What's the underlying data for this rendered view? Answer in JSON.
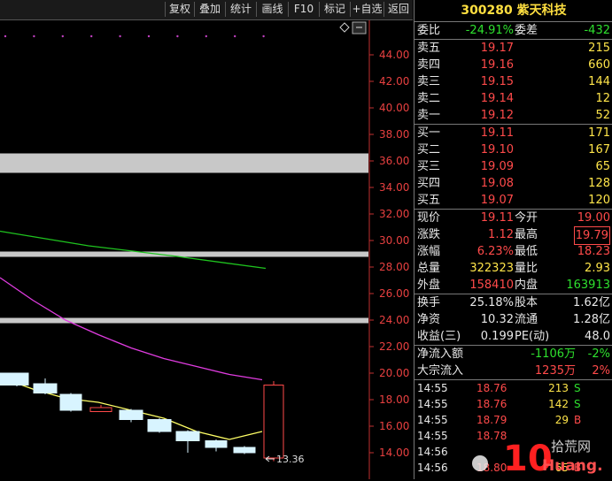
{
  "toolbar": {
    "buttons": [
      "复权",
      "叠加",
      "统计",
      "画线",
      "F10",
      "标记",
      "+自选",
      "返回"
    ]
  },
  "chart": {
    "y_ticks": [
      "44.00",
      "42.00",
      "40.00",
      "38.00",
      "36.00",
      "34.00",
      "32.00",
      "30.00",
      "28.00",
      "26.00",
      "24.00",
      "22.00",
      "20.00",
      "18.00",
      "16.00",
      "14.00"
    ],
    "low_label": "13.36",
    "corner_icon": "diamond-icon"
  },
  "chart_data": {
    "type": "candlestick",
    "ylim": [
      13,
      45.2
    ],
    "y_ticks": [
      44,
      42,
      40,
      38,
      36,
      34,
      32,
      30,
      28,
      26,
      24,
      22,
      20,
      18,
      16,
      14
    ],
    "candles": [
      {
        "open": 20.0,
        "close": 19.1,
        "high": 20.0,
        "low": 19.0,
        "dir": "down"
      },
      {
        "open": 19.2,
        "close": 18.5,
        "high": 19.6,
        "low": 18.4,
        "dir": "down"
      },
      {
        "open": 18.4,
        "close": 17.2,
        "high": 18.5,
        "low": 17.1,
        "dir": "down"
      },
      {
        "open": 17.1,
        "close": 17.4,
        "high": 17.6,
        "low": 17.1,
        "dir": "up"
      },
      {
        "open": 17.2,
        "close": 16.5,
        "high": 17.3,
        "low": 16.3,
        "dir": "down"
      },
      {
        "open": 16.5,
        "close": 15.6,
        "high": 16.6,
        "low": 15.5,
        "dir": "down"
      },
      {
        "open": 15.6,
        "close": 14.9,
        "high": 15.7,
        "low": 14.0,
        "dir": "down"
      },
      {
        "open": 14.9,
        "close": 14.4,
        "high": 15.0,
        "low": 14.1,
        "dir": "down"
      },
      {
        "open": 14.4,
        "close": 14.0,
        "high": 14.5,
        "low": 13.9,
        "dir": "down"
      },
      {
        "open": 13.6,
        "close": 19.1,
        "high": 19.4,
        "low": 13.36,
        "dir": "up"
      }
    ],
    "ma_green": {
      "x_start": 0,
      "values": [
        30.7,
        29.6,
        28.8,
        27.9
      ]
    },
    "ma_magenta": {
      "values": [
        27.2,
        25.5,
        24.0,
        22.9,
        21.9,
        21.1,
        20.5,
        19.9,
        19.5
      ]
    },
    "ma_yellow": {
      "values": [
        19.7,
        18.8,
        18.1,
        17.8,
        17.2,
        16.6,
        15.6,
        15.0,
        15.6
      ]
    },
    "bands": [
      35.9,
      28.5,
      23.5
    ]
  },
  "quote": {
    "code": "300280",
    "name": "紫天科技",
    "title": "300280 紫天科技",
    "weibi_label": "委比",
    "weibi": "-24.91%",
    "weicha_label": "委差",
    "weicha": "-432",
    "sells": [
      {
        "label": "卖五",
        "price": "19.17",
        "vol": "215"
      },
      {
        "label": "卖四",
        "price": "19.16",
        "vol": "660"
      },
      {
        "label": "卖三",
        "price": "19.15",
        "vol": "144"
      },
      {
        "label": "卖二",
        "price": "19.14",
        "vol": "12"
      },
      {
        "label": "卖一",
        "price": "19.12",
        "vol": "52"
      }
    ],
    "buys": [
      {
        "label": "买一",
        "price": "19.11",
        "vol": "171"
      },
      {
        "label": "买二",
        "price": "19.10",
        "vol": "167"
      },
      {
        "label": "买三",
        "price": "19.09",
        "vol": "65"
      },
      {
        "label": "买四",
        "price": "19.08",
        "vol": "128"
      },
      {
        "label": "买五",
        "price": "19.07",
        "vol": "120"
      }
    ],
    "stats": [
      {
        "l1": "现价",
        "v1": "19.11",
        "l2": "今开",
        "v2": "19.00"
      },
      {
        "l1": "涨跌",
        "v1": "1.12",
        "l2": "最高",
        "v2": "19.79"
      },
      {
        "l1": "涨幅",
        "v1": "6.23%",
        "l2": "最低",
        "v2": "18.23"
      },
      {
        "l1": "总量",
        "v1": "322323",
        "l2": "量比",
        "v2": "2.93"
      },
      {
        "l1": "外盘",
        "v1": "158410",
        "l2": "内盘",
        "v2": "163913"
      }
    ],
    "stats2": [
      {
        "l1": "换手",
        "v1": "25.18%",
        "l2": "股本",
        "v2": "1.62亿"
      },
      {
        "l1": "净资",
        "v1": "10.32",
        "l2": "流通",
        "v2": "1.28亿"
      },
      {
        "l1": "收益(三)",
        "v1": "0.199",
        "l2": "PE(动)",
        "v2": "48.0"
      }
    ],
    "flow": [
      {
        "label": "净流入额",
        "value": "-1106万",
        "pct": "-2%"
      },
      {
        "label": "大宗流入",
        "value": "1235万",
        "pct": "2%"
      }
    ],
    "trades": [
      {
        "time": "14:55",
        "price": "18.76",
        "vol": "213",
        "flag": "S"
      },
      {
        "time": "14:55",
        "price": "18.76",
        "vol": "142",
        "flag": "S"
      },
      {
        "time": "14:55",
        "price": "18.79",
        "vol": "29",
        "flag": "B"
      },
      {
        "time": "14:55",
        "price": "18.78",
        "vol": "",
        "flag": ""
      },
      {
        "time": "14:56",
        "price": "",
        "vol": "",
        "flag": ""
      },
      {
        "time": "14:56",
        "price": "18.80",
        "vol": "65",
        "flag": "B"
      }
    ]
  },
  "watermark": {
    "text": "拾荒网",
    "site": "Huang.CN",
    "digits": "10"
  },
  "colors": {
    "up": "#ff4a4a",
    "down": "#2ee02e",
    "neutral": "#ffe54a",
    "candle_down_fill": "#d8f4ff",
    "ma_green": "#1fc41f",
    "ma_magenta": "#e03ce0",
    "ma_yellow": "#ffff66"
  }
}
